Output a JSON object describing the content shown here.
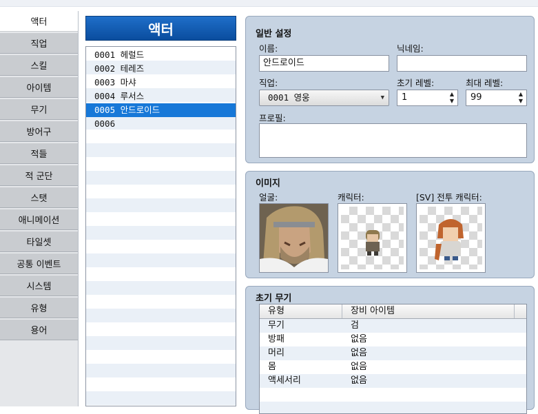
{
  "tabs": [
    "액터",
    "직업",
    "스킬",
    "아이템",
    "무기",
    "방어구",
    "적들",
    "적 군단",
    "스탯",
    "애니메이션",
    "타일셋",
    "공통 이벤트",
    "시스템",
    "유형",
    "용어"
  ],
  "actor_list": {
    "title": "액터",
    "items": [
      "0001 헤럴드",
      "0002 테레즈",
      "0003 마샤",
      "0004 루서스",
      "0005 안드로이드",
      "0006"
    ],
    "selected": "0005 안드로이드"
  },
  "general": {
    "title": "일반 설정",
    "name_label": "이름:",
    "name_value": "안드로이드",
    "nickname_label": "닉네임:",
    "nickname_value": "",
    "class_label": "직업:",
    "class_value": "0001 영웅",
    "initial_level_label": "초기 레벨:",
    "initial_level_value": "1",
    "max_level_label": "최대 레벨:",
    "max_level_value": "99",
    "profile_label": "프로필:",
    "profile_value": ""
  },
  "images": {
    "title": "이미지",
    "face_label": "얼굴:",
    "character_label": "캐릭터:",
    "sv_label": "[SV] 전투 캐릭터:"
  },
  "equipment": {
    "title": "초기 무기",
    "col_type": "유형",
    "col_item": "장비 아이템",
    "rows": [
      {
        "type": "무기",
        "item": "검"
      },
      {
        "type": "방패",
        "item": "없음"
      },
      {
        "type": "머리",
        "item": "없음"
      },
      {
        "type": "몸",
        "item": "없음"
      },
      {
        "type": "액세서리",
        "item": "없음"
      }
    ]
  },
  "colors": {
    "accent": "#1778d8",
    "panel": "#c6d3e2",
    "tab": "#c9ccd0"
  },
  "icons": {
    "caret": "chevron-down-icon",
    "spin": "spinner-arrows-icon"
  }
}
